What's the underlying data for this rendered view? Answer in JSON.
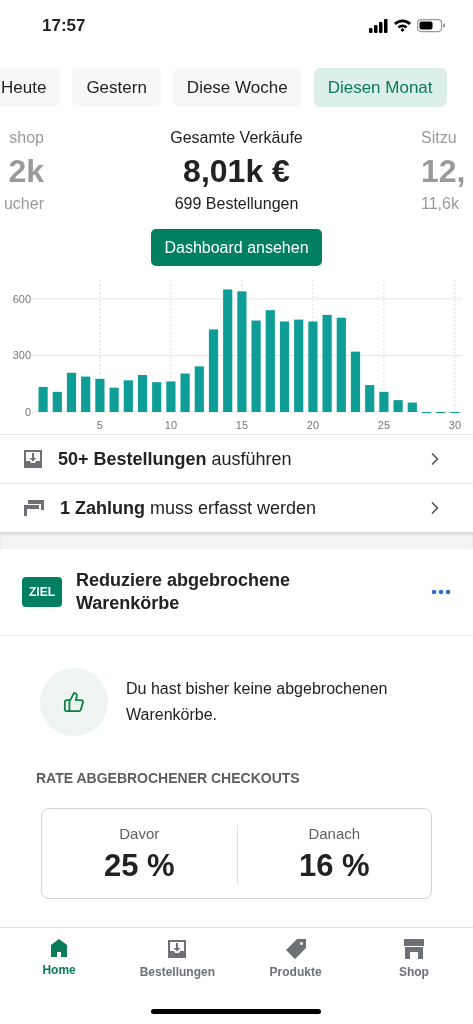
{
  "status_bar": {
    "time": "17:57"
  },
  "tabs": [
    {
      "label": "Heute",
      "selected": false
    },
    {
      "label": "Gestern",
      "selected": false
    },
    {
      "label": "Diese Woche",
      "selected": false
    },
    {
      "label": "Diesen Monat",
      "selected": true
    }
  ],
  "metrics": [
    {
      "title": "shop",
      "value": "2k",
      "sub": "ucher"
    },
    {
      "title": "Gesamte Verkäufe",
      "value": "8,01k €",
      "sub": "699 Bestellungen"
    },
    {
      "title": "Sitzu",
      "value": "12,",
      "sub": "11,6k"
    }
  ],
  "dashboard_button": "Dashboard ansehen",
  "chart_data": {
    "type": "bar",
    "x": [
      1,
      2,
      3,
      4,
      5,
      6,
      7,
      8,
      9,
      10,
      11,
      12,
      13,
      14,
      15,
      16,
      17,
      18,
      19,
      20,
      21,
      22,
      23,
      24,
      25,
      26,
      27,
      28,
      29,
      30
    ],
    "grid": true,
    "series": [
      {
        "color": "#0f9e97",
        "values": [
          133,
          107,
          208,
          188,
          176,
          129,
          168,
          196,
          158,
          162,
          204,
          242,
          438,
          650,
          640,
          485,
          540,
          480,
          490,
          480,
          515,
          500,
          320,
          143,
          107,
          63,
          50,
          0,
          0,
          0
        ]
      }
    ],
    "xlim": [
      0.5,
      30.5
    ],
    "ylim": [
      0,
      700
    ],
    "yticks": [
      0,
      300,
      600
    ],
    "xticks": [
      5,
      10,
      15,
      20,
      25,
      30
    ]
  },
  "tasks": [
    {
      "kind": "orders",
      "text": "**50+ Bestellungen** ausführen"
    },
    {
      "kind": "payment",
      "text": "**1 Zahlung** muss erfasst werden"
    }
  ],
  "goal": {
    "badge": "ZIEL",
    "title": "Reduziere abgebrochene Warenkörbe",
    "message": "Du hast bisher keine abgebrochenen Warenkörbe.",
    "section_title": "RATE ABGEBROCHENER CHECKOUTS",
    "stats": [
      {
        "label": "Davor",
        "value": "25 %"
      },
      {
        "label": "Danach",
        "value": "16 %"
      }
    ]
  },
  "nav": [
    {
      "kind": "home",
      "label": "Home",
      "selected": true
    },
    {
      "kind": "orders",
      "label": "Bestellungen",
      "selected": false
    },
    {
      "kind": "products",
      "label": "Produkte",
      "selected": false
    },
    {
      "kind": "shop",
      "label": "Shop",
      "selected": false
    }
  ]
}
